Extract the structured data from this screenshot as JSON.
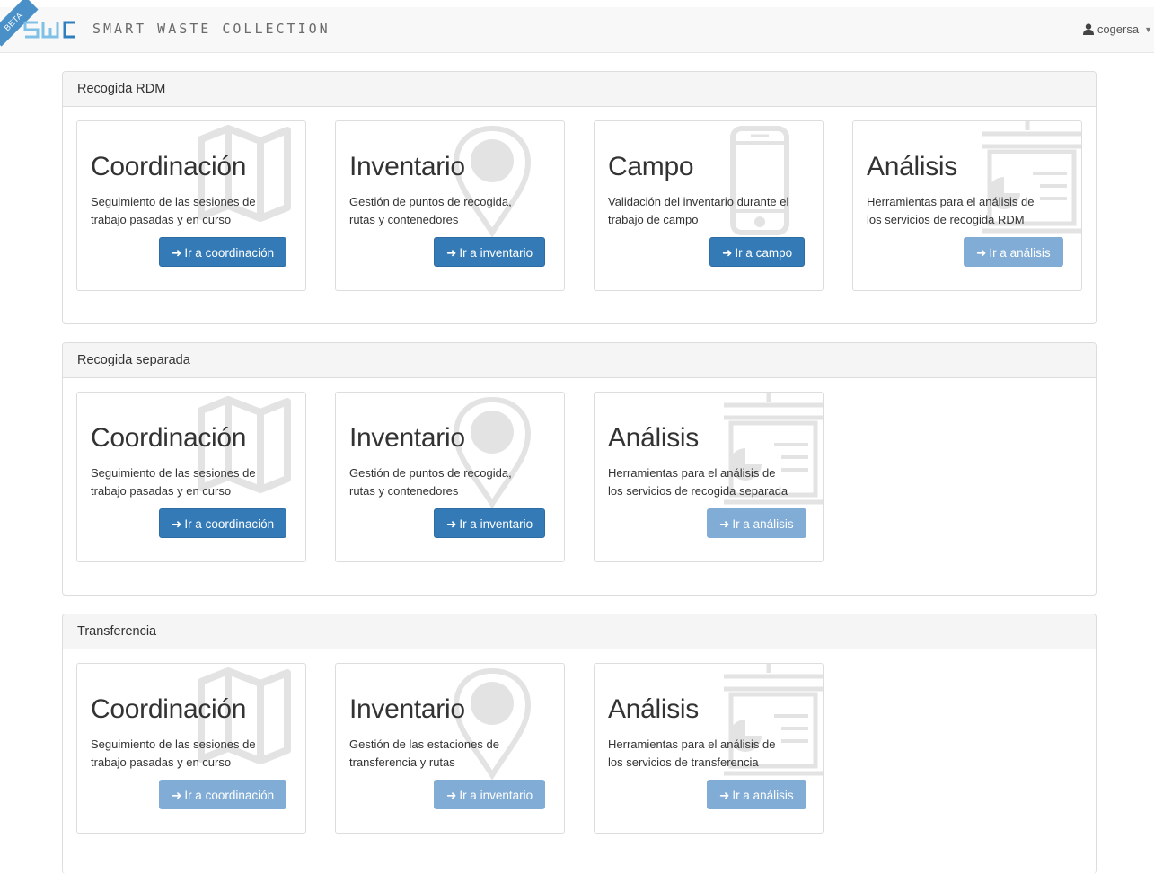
{
  "nav": {
    "beta": "BETA",
    "logo_text": "SWC",
    "brand": "SMART WASTE COLLECTION",
    "user": "cogersa"
  },
  "sections": [
    {
      "heading": "Recogida RDM",
      "cards": [
        {
          "title": "Coordinación",
          "desc1": "Seguimiento de las sesiones de",
          "desc2": "trabajo pasadas y en curso",
          "button": "Ir a coordinación",
          "icon": "map-icon",
          "enabled": true
        },
        {
          "title": "Inventario",
          "desc1": "Gestión de puntos de recogida,",
          "desc2": "rutas y contenedores",
          "button": "Ir a inventario",
          "icon": "map-marker-icon",
          "enabled": true
        },
        {
          "title": "Campo",
          "desc1": "Validación del inventario durante el",
          "desc2": "trabajo de campo",
          "button": "Ir a campo",
          "icon": "mobile-phone-icon",
          "enabled": true
        },
        {
          "title": "Análisis",
          "desc1": "Herramientas para el análisis de",
          "desc2": "los servicios de recogida RDM",
          "button": "Ir a análisis",
          "icon": "report-icon",
          "enabled": false
        }
      ]
    },
    {
      "heading": "Recogida separada",
      "cards": [
        {
          "title": "Coordinación",
          "desc1": "Seguimiento de las sesiones de",
          "desc2": "trabajo pasadas y en curso",
          "button": "Ir a coordinación",
          "icon": "map-icon",
          "enabled": true
        },
        {
          "title": "Inventario",
          "desc1": "Gestión de puntos de recogida,",
          "desc2": "rutas y contenedores",
          "button": "Ir a inventario",
          "icon": "map-marker-icon",
          "enabled": true
        },
        {
          "title": "Análisis",
          "desc1": "Herramientas para el análisis de",
          "desc2": "los servicios de recogida separada",
          "button": "Ir a análisis",
          "icon": "report-icon",
          "enabled": false
        }
      ]
    },
    {
      "heading": "Transferencia",
      "cards": [
        {
          "title": "Coordinación",
          "desc1": "Seguimiento de las sesiones de",
          "desc2": "trabajo pasadas y en curso",
          "button": "Ir a coordinación",
          "icon": "map-icon",
          "enabled": false
        },
        {
          "title": "Inventario",
          "desc1": "Gestión de las estaciones de",
          "desc2": "transferencia y rutas",
          "button": "Ir a inventario",
          "icon": "map-marker-icon",
          "enabled": false
        },
        {
          "title": "Análisis",
          "desc1": "Herramientas para el análisis de",
          "desc2": "los servicios de transferencia",
          "button": "Ir a análisis",
          "icon": "report-icon",
          "enabled": false
        }
      ]
    }
  ]
}
